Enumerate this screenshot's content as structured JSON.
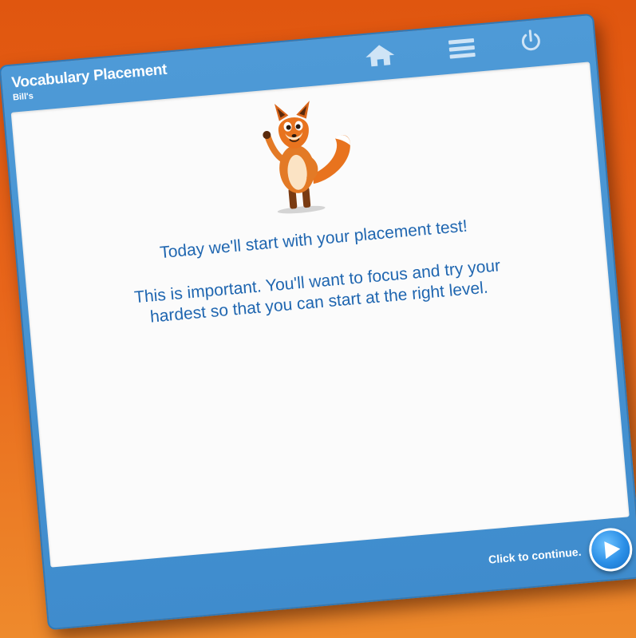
{
  "header": {
    "title": "Vocabulary Placement",
    "user": "Bill's"
  },
  "toolbar": {
    "home_icon": "home-icon",
    "menu_icon": "menu-icon",
    "power_icon": "power-icon"
  },
  "main": {
    "headline": "Today we'll start with your placement test!",
    "body": "This is important. You'll want to focus and try your hardest so that you can start at the right level.",
    "mascot": "fox-mascot"
  },
  "footer": {
    "continue_label": "Click to continue.",
    "continue_icon": "play-icon"
  },
  "colors": {
    "background": "#e8651a",
    "window": "#4e9ad7",
    "text": "#1f66b0",
    "button": "#2a8ee6"
  }
}
